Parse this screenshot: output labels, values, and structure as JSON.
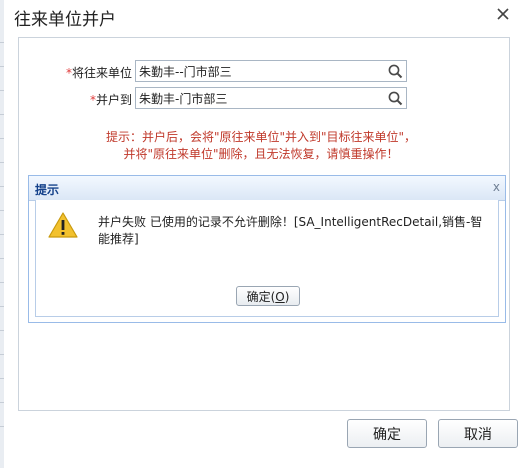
{
  "dialog": {
    "title": "往来单位并户"
  },
  "form": {
    "source": {
      "required_mark": "*",
      "label": "将往来单位",
      "value": "朱勤丰--门市部三"
    },
    "target": {
      "required_mark": "*",
      "label": "并户到",
      "value": "朱勤丰-门市部三"
    },
    "tip_line1": "提示：并户后，会将\"原往来单位\"并入到\"目标往来单位\"，",
    "tip_line2": "并将\"原往来单位\"删除，且无法恢复，请慎重操作！"
  },
  "messagebox": {
    "title": "提示",
    "close": "x",
    "message": "并户失败 已使用的记录不允许删除！[SA_IntelligentRecDetail,销售-智能推荐]",
    "ok_label": "确定(",
    "ok_key": "O",
    "ok_suffix": ")"
  },
  "footer": {
    "confirm_label": "确定",
    "cancel_label": "取消"
  },
  "colors": {
    "required": "#e03b3b",
    "tip": "#c0392b",
    "msgbox_title": "#15428b",
    "warning": "#f2c12e"
  },
  "icons": {
    "close": "close-icon",
    "search": "search-icon",
    "warning": "warning-icon"
  }
}
